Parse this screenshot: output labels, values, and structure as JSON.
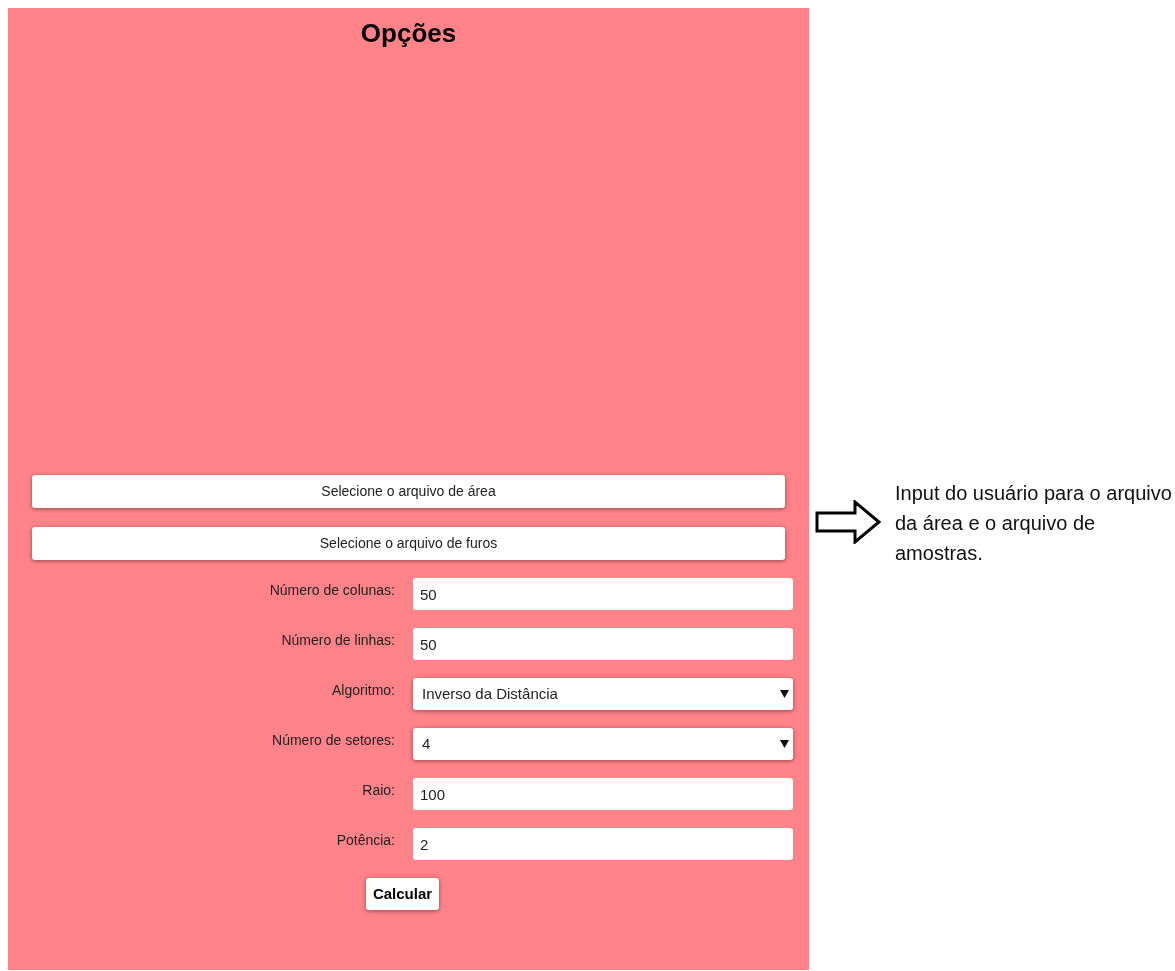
{
  "panel": {
    "title": "Opções",
    "file_buttons": [
      "Selecione o arquivo de área",
      "Selecione o arquivo de furos"
    ],
    "fields": [
      {
        "label": "Número de colunas:",
        "kind": "text",
        "value": "50"
      },
      {
        "label": "Número de linhas:",
        "kind": "text",
        "value": "50"
      },
      {
        "label": "Algoritmo:",
        "kind": "select",
        "value": "Inverso da Distância"
      },
      {
        "label": "Número de setores:",
        "kind": "select",
        "value": "4"
      },
      {
        "label": "Raio:",
        "kind": "text",
        "value": "100"
      },
      {
        "label": "Potência:",
        "kind": "text",
        "value": "2"
      }
    ],
    "submit": "Calcular"
  },
  "annotation": {
    "text": "Input do usuário para o arquivo da área e o arquivo de amostras."
  }
}
